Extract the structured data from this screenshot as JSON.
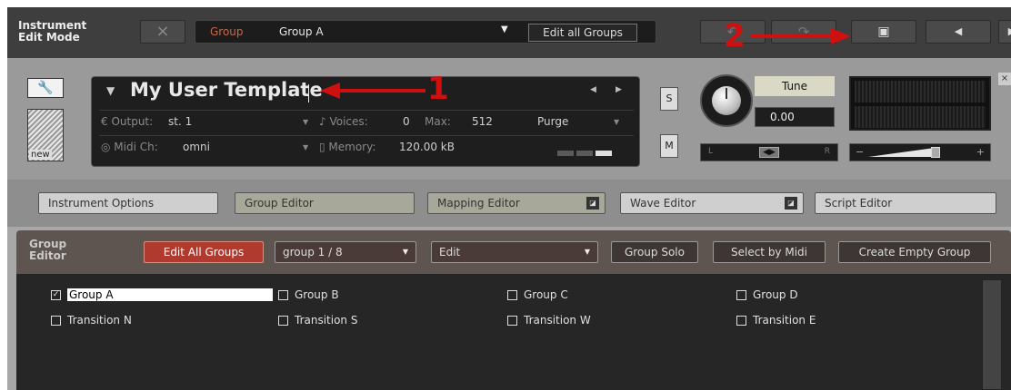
{
  "topbar": {
    "mode_title_line1": "Instrument",
    "mode_title_line2": "Edit Mode",
    "close_glyph": "×",
    "group_label": "Group",
    "group_value": "Group A",
    "group_chevron": "▼",
    "edit_all_groups": "Edit all Groups",
    "undo_glyph": "↶",
    "redo_glyph": "↷",
    "save_glyph": "▣",
    "prev_glyph": "◀",
    "next_glyph": "▶"
  },
  "instrument": {
    "wrench_glyph": "🔧",
    "new_label": "new",
    "name": "My User Template",
    "output_label": "€ Output:",
    "output_value": "st. 1",
    "voices_label": "♪ Voices:",
    "voices_value": "0",
    "max_label": "Max:",
    "max_value": "512",
    "purge_label": "Purge",
    "midi_label": "◎ Midi Ch:",
    "midi_value": "omni",
    "memory_label": "▯ Memory:",
    "memory_value": "120.00 kB",
    "nav_left": "◀",
    "nav_right": "▶",
    "solo": "S",
    "mute": "M",
    "tune_label": "Tune",
    "tune_value": "0.00",
    "pan_left": "L",
    "pan_right": "R",
    "pan_mid": "◀▶",
    "vol_minus": "−",
    "vol_plus": "+",
    "volume_level": 0.65,
    "close": "×"
  },
  "tabs": [
    {
      "label": "Instrument Options",
      "active": false,
      "icon": ""
    },
    {
      "label": "Group Editor",
      "active": true,
      "icon": ""
    },
    {
      "label": "Mapping Editor",
      "active": true,
      "icon": "◪"
    },
    {
      "label": "Wave Editor",
      "active": false,
      "icon": "◪"
    },
    {
      "label": "Script Editor",
      "active": false,
      "icon": ""
    }
  ],
  "group_editor": {
    "title_line1": "Group",
    "title_line2": "Editor",
    "edit_all_groups": "Edit All Groups",
    "group_select": "group 1 / 8",
    "edit_select": "Edit",
    "group_solo": "Group Solo",
    "select_by_midi": "Select by Midi",
    "create_empty_group": "Create Empty Group",
    "dropdown_chevron": "▼",
    "groups": [
      {
        "name": "Group A",
        "checked": true
      },
      {
        "name": "Group B",
        "checked": false
      },
      {
        "name": "Group C",
        "checked": false
      },
      {
        "name": "Group D",
        "checked": false
      },
      {
        "name": "Transition N",
        "checked": false
      },
      {
        "name": "Transition S",
        "checked": false
      },
      {
        "name": "Transition W",
        "checked": false
      },
      {
        "name": "Transition E",
        "checked": false
      }
    ]
  },
  "annotations": {
    "arrow1_number": "1",
    "arrow2_number": "2"
  },
  "colors": {
    "annotation_red": "#d01010",
    "edit_all_groups_red": "#b03a2e"
  }
}
